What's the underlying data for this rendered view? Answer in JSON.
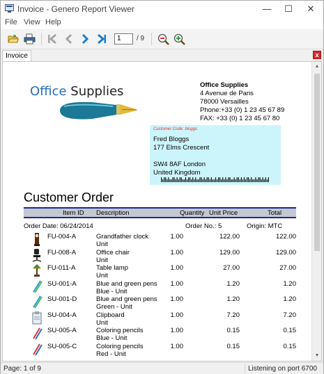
{
  "window": {
    "title": "Invoice - Genero Report Viewer",
    "minimize": "—",
    "maximize": "☐",
    "close": "✕"
  },
  "menu": [
    "File",
    "View",
    "Help"
  ],
  "toolbar": {
    "page_value": "1",
    "page_total": "/ 9"
  },
  "tab": {
    "label": "Invoice",
    "close": "x"
  },
  "report": {
    "logo": {
      "word1": "Office",
      "word2": " Supplies"
    },
    "company": {
      "name": "Office Supplies",
      "address1": "4 Avenue de Paris",
      "address2": "78000 Versailles",
      "phone": "Phone:+33 (0) 1 23 45 67 89",
      "fax": "FAX:    +33 (0) 1 23 45 67 80"
    },
    "customer": {
      "code_label": "Customer Code:  bloggs",
      "name": "Fred Bloggs",
      "street": "177 Elms Crescent",
      "postcode": "SW4 8AF London",
      "country": "United Kingdom"
    },
    "title": "Customer Order",
    "columns": {
      "item_id": "Item ID",
      "description": "Description",
      "quantity": "Quantity",
      "unit_price": "Unit Price",
      "total": "Total"
    },
    "order_date": "Order Date: 06/24/2014",
    "order_no_label": "Order No.:",
    "order_no": "5",
    "origin": "Origin: MTC",
    "rows": [
      {
        "icon": "clock-icon",
        "id": "FU-004-A",
        "desc": "Grandfather clock",
        "sub": "Unit",
        "qty": "1.00",
        "price": "122.00",
        "total": "122.00"
      },
      {
        "icon": "chair-icon",
        "id": "FU-008-A",
        "desc": "Office chair",
        "sub": "Unit",
        "qty": "1.00",
        "price": "129.00",
        "total": "129.00"
      },
      {
        "icon": "lamp-icon",
        "id": "FU-011-A",
        "desc": "Table lamp",
        "sub": "Unit",
        "qty": "1.00",
        "price": "27.00",
        "total": "27.00"
      },
      {
        "icon": "pens-icon",
        "id": "SU-001-A",
        "desc": "Blue and green pens",
        "sub": "Blue - Unit",
        "qty": "1.00",
        "price": "1.20",
        "total": "1.20"
      },
      {
        "icon": "pens-icon",
        "id": "SU-001-D",
        "desc": "Blue and green pens",
        "sub": "Green - Unit",
        "qty": "1.00",
        "price": "1.20",
        "total": "1.20"
      },
      {
        "icon": "clipboard-icon",
        "id": "SU-004-A",
        "desc": "Clipboard",
        "sub": "Unit",
        "qty": "1.00",
        "price": "7.20",
        "total": "7.20"
      },
      {
        "icon": "pencils-icon",
        "id": "SU-005-A",
        "desc": "Coloring pencils",
        "sub": "Blue - Unit",
        "qty": "1.00",
        "price": "0.15",
        "total": "0.15"
      },
      {
        "icon": "pencils-icon",
        "id": "SU-005-C",
        "desc": "Coloring pencils",
        "sub": "Red - Unit",
        "qty": "1.00",
        "price": "0.15",
        "total": "0.15"
      }
    ]
  },
  "status": {
    "page": "Page: 1 of 9",
    "listening": "Listening on port 6700"
  }
}
